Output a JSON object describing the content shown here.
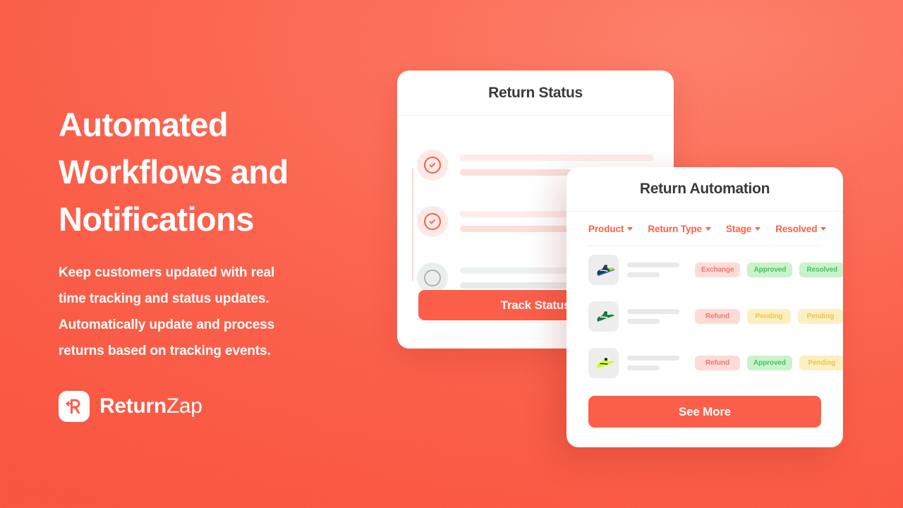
{
  "background": {
    "color": "#fb5f4a",
    "highlight_color": "#fd7f6b"
  },
  "hero": {
    "headline": "Automated\nWorkflows and\nNotifications",
    "subhead": "Keep customers updated with real\ntime tracking and status updates.\nAutomatically update and process\nreturns based on tracking events.",
    "brand": {
      "mark_icon": "returnzap-r-arrow-icon",
      "name_bold": "Return",
      "name_light": "Zap"
    }
  },
  "status_card": {
    "title": "Return Status",
    "steps": [
      {
        "state": "done",
        "icon": "check-circle-icon"
      },
      {
        "state": "done",
        "icon": "check-circle-icon"
      },
      {
        "state": "todo",
        "icon": "empty-circle-icon"
      }
    ],
    "track_button_label": "Track Status"
  },
  "automation_card": {
    "title": "Return Automation",
    "columns": [
      {
        "label": "Product",
        "icon": "chevron-down-icon"
      },
      {
        "label": "Return Type",
        "icon": "chevron-down-icon"
      },
      {
        "label": "Stage",
        "icon": "chevron-down-icon"
      },
      {
        "label": "Resolved",
        "icon": "chevron-down-icon"
      }
    ],
    "rows": [
      {
        "product_icon": "navy-sneaker-icon",
        "return_type": {
          "label": "Exchange",
          "tone": "red"
        },
        "stage": {
          "label": "Approved",
          "tone": "green"
        },
        "resolved": {
          "label": "Resolved",
          "tone": "green"
        }
      },
      {
        "product_icon": "green-sneaker-icon",
        "return_type": {
          "label": "Refund",
          "tone": "red"
        },
        "stage": {
          "label": "Pending",
          "tone": "yellow"
        },
        "resolved": {
          "label": "Pending",
          "tone": "yellow"
        }
      },
      {
        "product_icon": "neon-sneaker-icon",
        "return_type": {
          "label": "Refund",
          "tone": "red"
        },
        "stage": {
          "label": "Approved",
          "tone": "green"
        },
        "resolved": {
          "label": "Pending",
          "tone": "yellow"
        }
      }
    ],
    "see_more_label": "See More"
  },
  "colors": {
    "accent": "#fb5f4a",
    "badge_red_bg": "#fddcd8",
    "badge_red_fg": "#f2766a",
    "badge_green_bg": "#c9f2cd",
    "badge_green_fg": "#46c457",
    "badge_yellow_bg": "#fcf0c2",
    "badge_yellow_fg": "#eec544"
  }
}
